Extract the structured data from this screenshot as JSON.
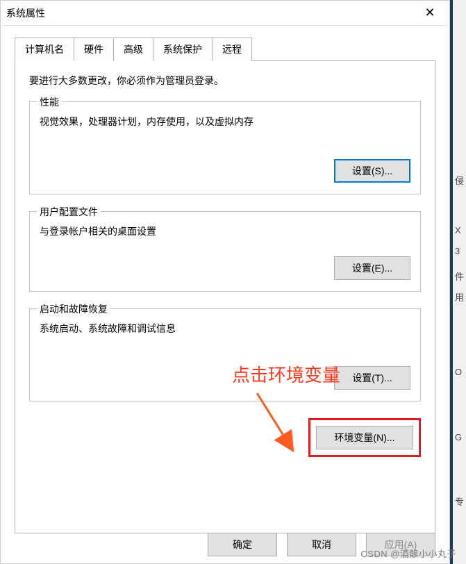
{
  "dialog": {
    "title": "系统属性",
    "close_label": "✕"
  },
  "tabs": {
    "items": [
      {
        "label": "计算机名"
      },
      {
        "label": "硬件"
      },
      {
        "label": "高级"
      },
      {
        "label": "系统保护"
      },
      {
        "label": "远程"
      }
    ],
    "active_index": 2
  },
  "advanced": {
    "intro": "要进行大多数更改，你必须作为管理员登录。",
    "performance": {
      "title": "性能",
      "desc": "视觉效果，处理器计划，内存使用，以及虚拟内存",
      "button": "设置(S)..."
    },
    "user_profiles": {
      "title": "用户配置文件",
      "desc": "与登录帐户相关的桌面设置",
      "button": "设置(E)..."
    },
    "startup": {
      "title": "启动和故障恢复",
      "desc": "系统启动、系统故障和调试信息",
      "button": "设置(T)..."
    },
    "env_button": "环境变量(N)..."
  },
  "footer": {
    "ok": "确定",
    "cancel": "取消",
    "apply": "应用(A)"
  },
  "annotation": {
    "text": "点击环境变量",
    "arrow_color": "#ff5a1f"
  },
  "side_chars": [
    "侵",
    "X",
    "3",
    "件",
    "用",
    "O",
    "G",
    "专"
  ],
  "watermark": "CSDN @酒酿小小丸子"
}
